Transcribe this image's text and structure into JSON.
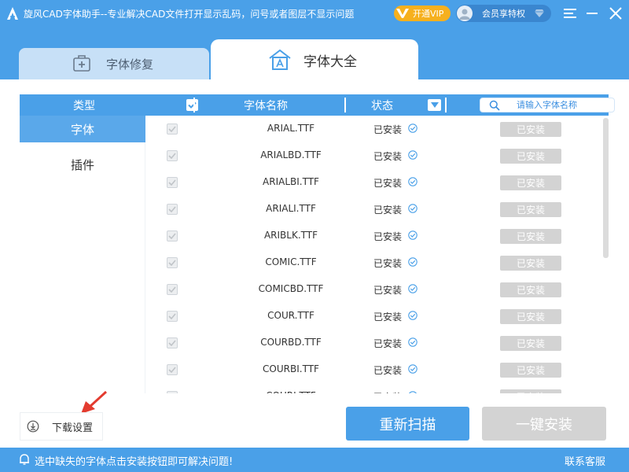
{
  "titlebar": {
    "title": "旋风CAD字体助手--专业解决CAD文件打开显示乱码，问号或者图层不显示问题",
    "vip_label": "开通VIP",
    "member_label": "会员享特权"
  },
  "tabs": [
    {
      "label": "字体修复",
      "active": false
    },
    {
      "label": "字体大全",
      "active": true
    }
  ],
  "table": {
    "headers": {
      "type": "类型",
      "font_name": "字体名称",
      "status": "状态"
    },
    "search_placeholder": "请输入字体名称"
  },
  "sidebar": {
    "items": [
      {
        "label": "字体",
        "active": true
      },
      {
        "label": "插件",
        "active": false
      }
    ]
  },
  "rows": [
    {
      "name": "ARIAL.TTF",
      "status": "已安装",
      "action": "已安装"
    },
    {
      "name": "ARIALBD.TTF",
      "status": "已安装",
      "action": "已安装"
    },
    {
      "name": "ARIALBI.TTF",
      "status": "已安装",
      "action": "已安装"
    },
    {
      "name": "ARIALI.TTF",
      "status": "已安装",
      "action": "已安装"
    },
    {
      "name": "ARIBLK.TTF",
      "status": "已安装",
      "action": "已安装"
    },
    {
      "name": "COMIC.TTF",
      "status": "已安装",
      "action": "已安装"
    },
    {
      "name": "COMICBD.TTF",
      "status": "已安装",
      "action": "已安装"
    },
    {
      "name": "COUR.TTF",
      "status": "已安装",
      "action": "已安装"
    },
    {
      "name": "COURBD.TTF",
      "status": "已安装",
      "action": "已安装"
    },
    {
      "name": "COURBI.TTF",
      "status": "已安装",
      "action": "已安装"
    },
    {
      "name": "COURI.TTF",
      "status": "已安装",
      "action": "已安装"
    }
  ],
  "bottom": {
    "download_settings": "下载设置",
    "rescan": "重新扫描",
    "one_click_install": "一键安装"
  },
  "statusbar": {
    "message": "选中缺失的字体点击安装按钮即可解决问题!",
    "support": "联系客服"
  },
  "colors": {
    "primary": "#4aa0e8",
    "vip": "#f6b01e",
    "disabled": "#d3d3d3"
  }
}
